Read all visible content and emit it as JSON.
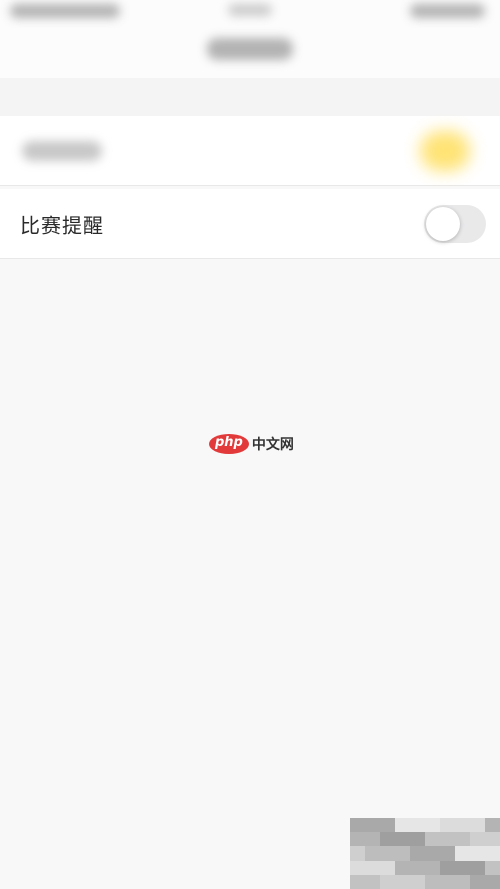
{
  "status_bar": {
    "obscured": true
  },
  "nav_bar": {
    "obscured": true
  },
  "settings": {
    "rows": [
      {
        "label": "",
        "obscured": true,
        "toggle_on": true
      },
      {
        "label": "比赛提醒",
        "toggle_on": false
      }
    ]
  },
  "watermark": {
    "logo": "php",
    "text": "中文网"
  },
  "colors": {
    "background": "#f8f8f8",
    "toggle_off": "#e9e9ea",
    "toggle_on": "#ffe066",
    "watermark_red": "#e23a3a"
  }
}
